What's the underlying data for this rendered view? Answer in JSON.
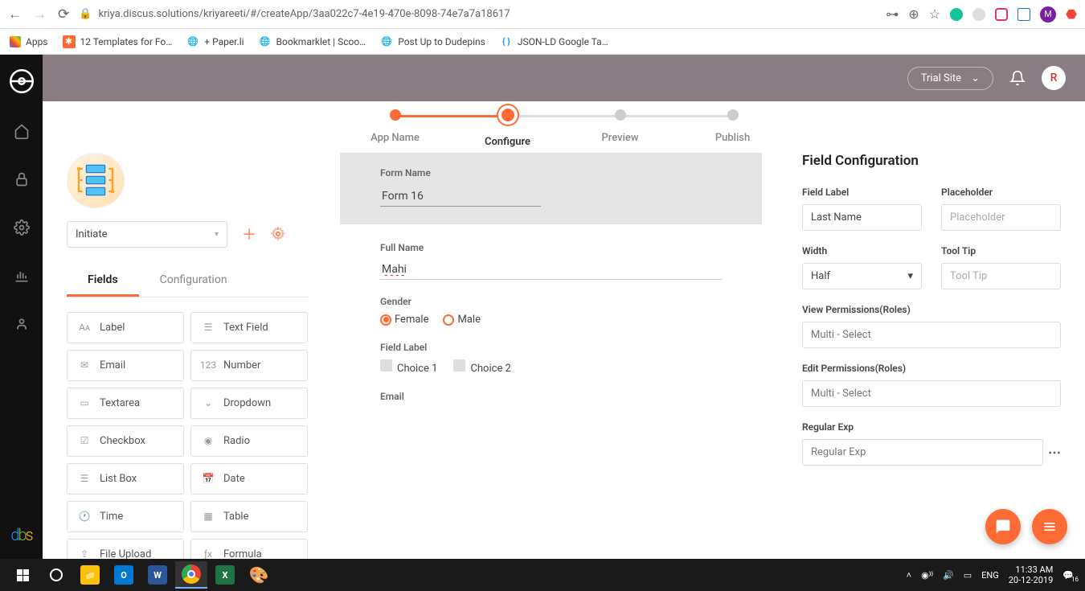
{
  "browser": {
    "url": "kriya.discus.solutions/kriyareeti/#/createApp/3aa022c7-4e19-470e-8098-74e7a7a18617",
    "avatar": "M"
  },
  "bookmarks": {
    "apps": "Apps",
    "templates": "12 Templates for Fo…",
    "paperli": "+ Paper.li",
    "scoop": "Bookmarklet | Scoo…",
    "dudepins": "Post Up to Dudepins",
    "jsonld": "JSON-LD Google Ta…"
  },
  "header": {
    "site_selector": "Trial Site",
    "avatar": "R"
  },
  "stepper": {
    "s1": "App Name",
    "s2": "Configure",
    "s3": "Preview",
    "s4": "Publish"
  },
  "left": {
    "stage": "Initiate",
    "tabs": {
      "fields": "Fields",
      "config": "Configuration"
    },
    "fields": {
      "label": "Label",
      "textfield": "Text Field",
      "email": "Email",
      "number": "Number",
      "textarea": "Textarea",
      "dropdown": "Dropdown",
      "checkbox": "Checkbox",
      "radio": "Radio",
      "listbox": "List Box",
      "date": "Date",
      "time": "Time",
      "table": "Table",
      "fileupload": "File Upload",
      "formula": "Formula"
    }
  },
  "form": {
    "name_label": "Form Name",
    "name_value": "Form 16",
    "fullname_label": "Full Name",
    "fullname_value": "Mahi",
    "gender_label": "Gender",
    "gender_female": "Female",
    "gender_male": "Male",
    "fieldlabel": "Field Label",
    "choice1": "Choice 1",
    "choice2": "Choice 2",
    "email_label": "Email"
  },
  "config": {
    "title": "Field Configuration",
    "field_label": "Field Label",
    "field_label_value": "Last Name",
    "placeholder_label": "Placeholder",
    "placeholder_ph": "Placeholder",
    "width_label": "Width",
    "width_value": "Half",
    "tooltip_label": "Tool Tip",
    "tooltip_ph": "Tool Tip",
    "view_perm_label": "View Permissions(Roles)",
    "multi_select_ph": "Multi - Select",
    "edit_perm_label": "Edit Permissions(Roles)",
    "regex_label": "Regular Exp",
    "regex_ph": "Regular Exp"
  },
  "taskbar": {
    "lang": "ENG",
    "time": "11:33 AM",
    "date": "20-12-2019",
    "notif": "16"
  }
}
